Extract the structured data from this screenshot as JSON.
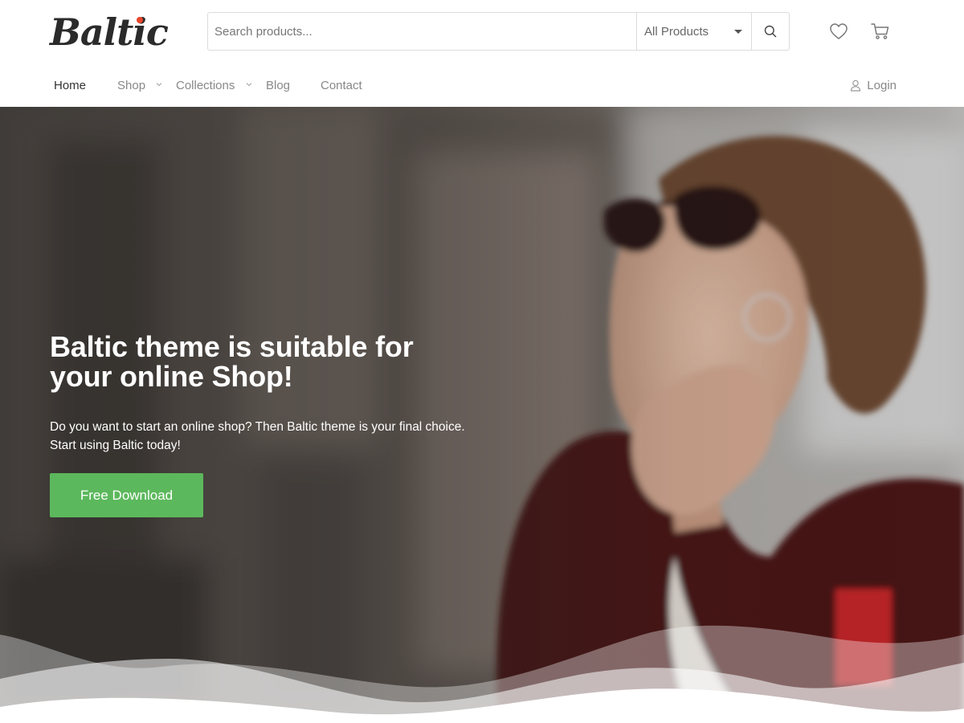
{
  "brand": {
    "logo_text": "Baltic",
    "accent_dot_color": "#e8452c"
  },
  "search": {
    "placeholder": "Search products...",
    "value": "",
    "category_selected": "All Products",
    "icons": {
      "submit": "search-icon",
      "caret": "chevron-down-icon"
    }
  },
  "header_icons": {
    "wishlist": "heart-icon",
    "cart": "cart-icon"
  },
  "nav": {
    "items": [
      {
        "label": "Home",
        "active": true
      },
      {
        "label": "Shop",
        "has_dropdown": true
      },
      {
        "label": "Collections",
        "has_dropdown": true
      },
      {
        "label": "Blog"
      },
      {
        "label": "Contact"
      }
    ],
    "login_label": "Login",
    "login_icon": "user-icon"
  },
  "hero": {
    "title_line1": "Baltic theme is suitable for",
    "title_line2": "your online Shop!",
    "subtitle_line1": "Do you want to start an online shop? Then Baltic theme is your final choice.",
    "subtitle_line2": "Start using Baltic today!",
    "cta_label": "Free Download",
    "cta_color": "#5cb85c"
  }
}
